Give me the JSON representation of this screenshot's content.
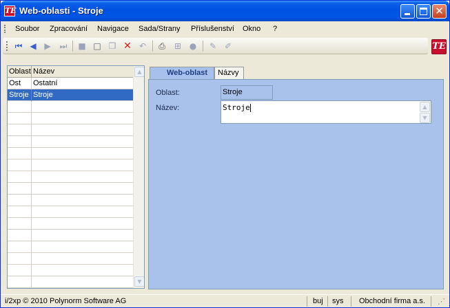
{
  "window": {
    "title": "Web-oblasti - Stroje",
    "app_icon": "TE"
  },
  "menu": {
    "items": [
      "Soubor",
      "Zpracování",
      "Navigace",
      "Sada/Strany",
      "Příslušenství",
      "Okno",
      "?"
    ]
  },
  "toolbar": {
    "icons": [
      "first-record-icon",
      "previous-record-icon",
      "next-record-icon",
      "last-record-icon",
      "save-icon",
      "new-icon",
      "copy-icon",
      "delete-icon",
      "undo-icon",
      "print-icon",
      "tree-icon",
      "record-status-icon",
      "edit-icon",
      "edit-alt-icon"
    ],
    "brand_logo": "TE"
  },
  "grid": {
    "columns": [
      "Oblast",
      "Název"
    ],
    "rows": [
      {
        "oblast": "Ost",
        "nazev": "Ostatní"
      },
      {
        "oblast": "Stroje",
        "nazev": "Stroje"
      }
    ],
    "selected_index": 1
  },
  "tabs": [
    {
      "label": "Web-oblast",
      "active": true
    },
    {
      "label": "Názvy",
      "active": false
    }
  ],
  "form": {
    "oblast_label": "Oblast:",
    "oblast_value": "Stroje",
    "nazev_label": "Název:",
    "nazev_value": "Stroje"
  },
  "status": {
    "copyright": "i/2xp © 2010 Polynorm Software AG",
    "user1": "buj",
    "user2": "sys",
    "company": "Obchodní firma a.s."
  },
  "colors": {
    "titlebar": "#0055e5",
    "selection": "#316ac5",
    "tab_page": "#a9c2ec",
    "brand": "#c8102e"
  }
}
